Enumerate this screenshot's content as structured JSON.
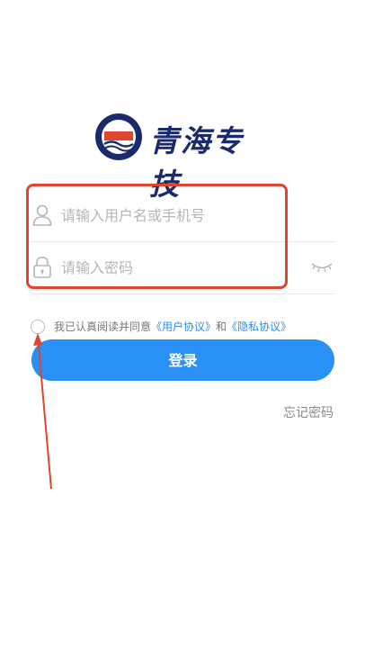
{
  "logo": {
    "text": "青海专技"
  },
  "login_form": {
    "username_placeholder": "请输入用户名或手机号",
    "password_placeholder": "请输入密码"
  },
  "agreement": {
    "prefix": "我已认真阅读并同意",
    "user_agreement": "《用户协议》",
    "and": "和",
    "privacy_policy": "《隐私协议》"
  },
  "actions": {
    "login_label": "登录",
    "forgot_password": "忘记密码"
  },
  "colors": {
    "primary": "#2990f6",
    "link": "#2d8cf0",
    "logo_navy": "#1a2a6c",
    "annotation_red": "#e0452d"
  },
  "icons": [
    "user-icon",
    "lock-icon",
    "eye-closed-icon",
    "logo-emblem"
  ]
}
